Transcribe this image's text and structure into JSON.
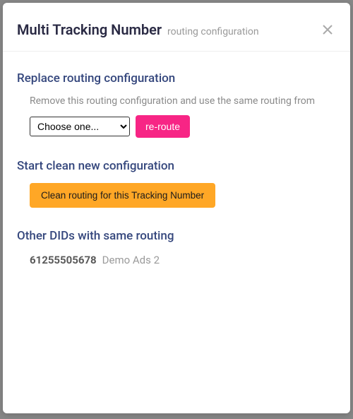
{
  "header": {
    "title": "Multi Tracking Number",
    "subtitle": "routing configuration"
  },
  "sections": {
    "replace": {
      "heading": "Replace routing configuration",
      "description": "Remove this routing configuration and use the same routing from",
      "select_placeholder": "Choose one...",
      "reroute_label": "re-route"
    },
    "clean": {
      "heading": "Start clean new configuration",
      "button_label": "Clean routing for this Tracking Number"
    },
    "other_dids": {
      "heading": "Other DIDs with same routing",
      "items": [
        {
          "number": "61255505678",
          "label": "Demo Ads 2"
        }
      ]
    }
  }
}
